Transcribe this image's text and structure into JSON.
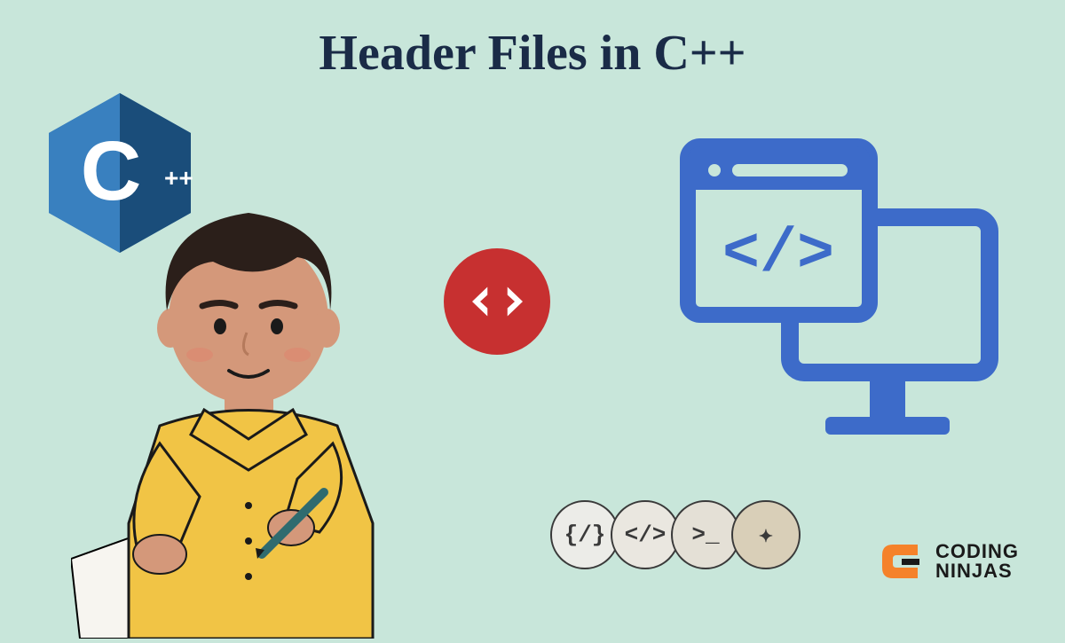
{
  "title": "Header Files in C++",
  "cpp_logo": {
    "letter": "C",
    "suffix": "++"
  },
  "symbols": {
    "s1": "{/}",
    "s2": "</>",
    "s3": ">_",
    "s4": "✦"
  },
  "brand": {
    "line1": "CODING",
    "line2": "NINJAS"
  },
  "colors": {
    "background": "#c8e6da",
    "title": "#1a2b47",
    "cpp_blue_dark": "#1a4d7a",
    "cpp_blue_light": "#2b6aa8",
    "red_badge": "#c73030",
    "monitor_blue": "#3d6bc9",
    "brand_orange": "#f5822a"
  }
}
